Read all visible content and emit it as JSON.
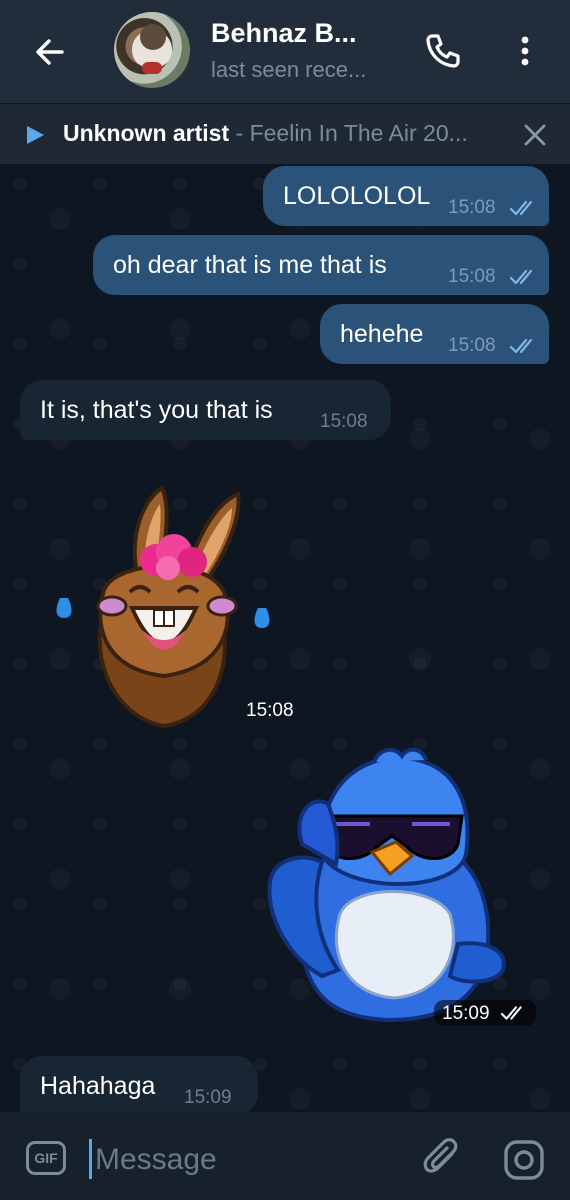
{
  "header": {
    "title": "Behnaz B...",
    "subtitle": "last seen rece..."
  },
  "player": {
    "artist": "Unknown artist",
    "separator": " - ",
    "song": "Feelin In The Air 20..."
  },
  "messages": [
    {
      "text": "LOLOLOLOL",
      "time": "15:08",
      "direction": "out",
      "status": "read"
    },
    {
      "text": "oh dear  that is me that is",
      "time": "15:08",
      "direction": "out",
      "status": "read"
    },
    {
      "text": "hehehe",
      "time": "15:08",
      "direction": "out",
      "status": "read"
    },
    {
      "text": "It is, that's you that is",
      "time": "15:08",
      "direction": "in"
    },
    {
      "sticker": "laughing-llama-sticker",
      "time": "15:08",
      "direction": "in"
    },
    {
      "sticker": "cool-bird-sticker",
      "time": "15:09",
      "direction": "out",
      "status": "read"
    },
    {
      "text": "Hahahaga",
      "time": "15:09",
      "direction": "in"
    }
  ],
  "input": {
    "gif_label": "GIF",
    "placeholder": "Message"
  },
  "colors": {
    "header_bg": "#212d3b",
    "chat_bg": "#0e1621",
    "outgoing_bubble": "#2b5278",
    "incoming_bubble": "#182533",
    "accent": "#5aa8e8"
  }
}
